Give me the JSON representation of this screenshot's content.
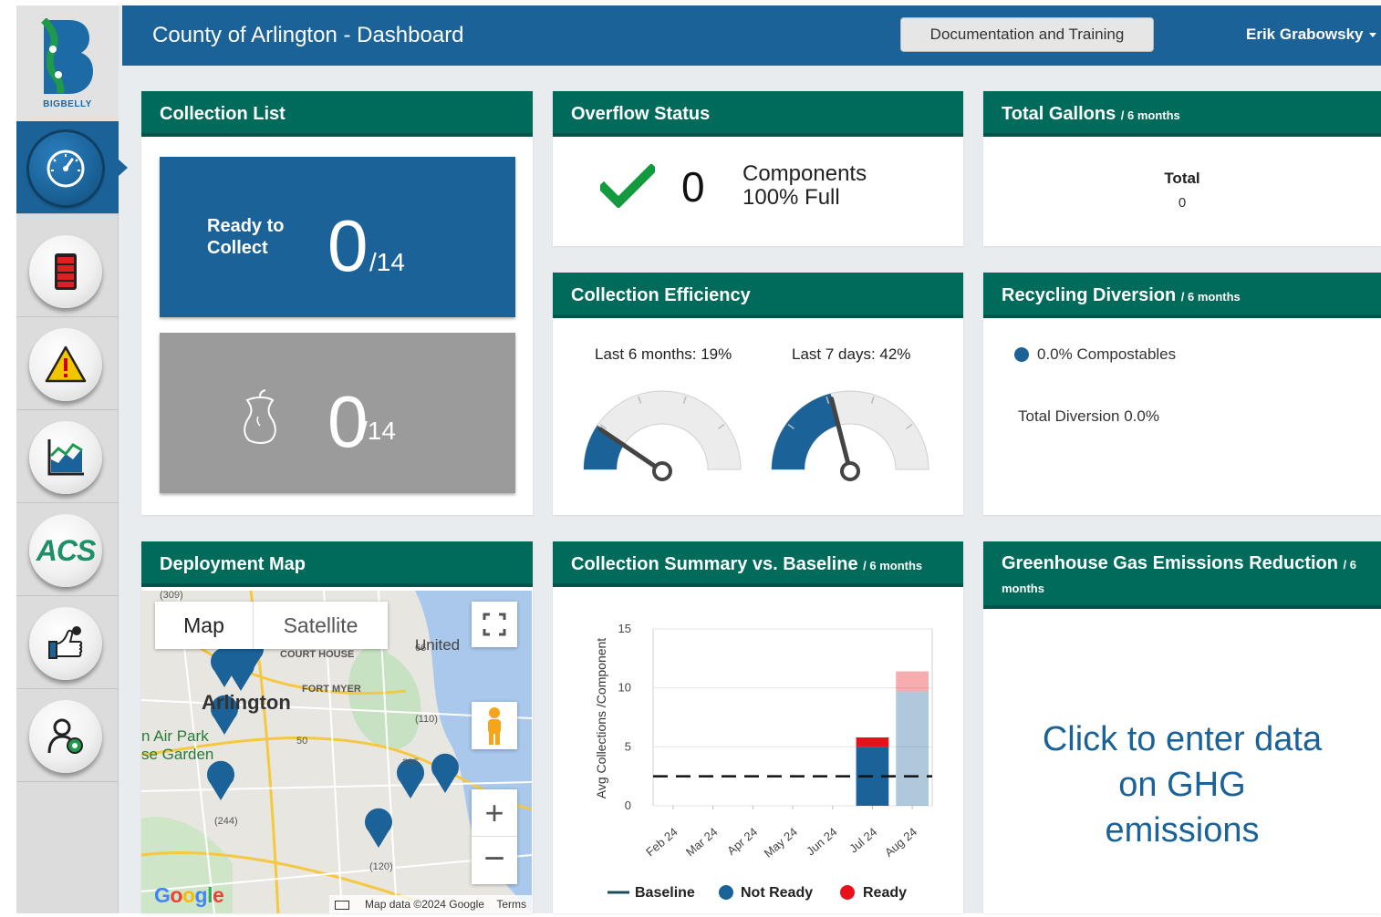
{
  "header": {
    "title": "County of Arlington - Dashboard",
    "doc_button": "Documentation and Training",
    "user": "Erik Grabowsky"
  },
  "sidebar": {
    "logo_text": "BIGBELLY",
    "items": [
      {
        "icon": "speedometer-icon",
        "active": true
      },
      {
        "icon": "fill-level-icon",
        "active": false
      },
      {
        "icon": "warning-icon",
        "active": false
      },
      {
        "icon": "chart-icon",
        "active": false
      },
      {
        "icon": "acs-icon",
        "label": "ACS",
        "active": false
      },
      {
        "icon": "service-hand-icon",
        "active": false
      },
      {
        "icon": "admin-user-icon",
        "active": false
      }
    ]
  },
  "collection_list": {
    "title": "Collection List",
    "ready_label": "Ready to Collect",
    "ready_count": "0",
    "ready_total": "/14",
    "compost_count": "0",
    "compost_total": "/14"
  },
  "overflow": {
    "title": "Overflow Status",
    "count": "0",
    "line1": "Components",
    "line2": "100% Full"
  },
  "total_gallons": {
    "title": "Total Gallons",
    "subtitle": "/ 6 months",
    "total_label": "Total",
    "total_value": "0"
  },
  "efficiency": {
    "title": "Collection Efficiency",
    "six_months_label": "Last 6 months: 19%",
    "seven_days_label": "Last 7 days: 42%",
    "six_months_pct": 19,
    "seven_days_pct": 42
  },
  "recycling": {
    "title": "Recycling Diversion",
    "subtitle": "/ 6 months",
    "item": "0.0% Compostables",
    "total": "Total Diversion  0.0%"
  },
  "map": {
    "title": "Deployment Map",
    "map_tab": "Map",
    "satellite_tab": "Satellite",
    "labels": [
      "Arlington",
      "COURT HOUSE",
      "FORT MYER",
      "United",
      "n Air Park",
      "se Garden"
    ],
    "attribution": "Map data ©2024 Google",
    "terms": "Terms",
    "google": "Google"
  },
  "summary": {
    "title": "Collection Summary vs. Baseline",
    "subtitle": "/ 6 months"
  },
  "chart_data": {
    "type": "bar",
    "categories": [
      "Feb 24",
      "Mar 24",
      "Apr 24",
      "May 24",
      "Jun 24",
      "Jul 24",
      "Aug 24"
    ],
    "series": [
      {
        "name": "Not Ready",
        "values": [
          0,
          0,
          0,
          0,
          0,
          5,
          9.7
        ],
        "color": "#1a6298"
      },
      {
        "name": "Ready",
        "values": [
          0,
          0,
          0,
          0,
          0,
          0.8,
          1.7
        ],
        "color": "#e8101a"
      }
    ],
    "baseline": {
      "name": "Baseline",
      "value": 2.5
    },
    "ylabel": "Avg Collections /Component",
    "yticks": [
      "0",
      "5",
      "10",
      "15"
    ],
    "ylim": [
      0,
      15
    ],
    "legend": [
      "Baseline",
      "Not Ready",
      "Ready"
    ],
    "legend_position": "bottom"
  },
  "ghg": {
    "title": "Greenhouse Gas Emissions Reduction",
    "subtitle": "/ 6 months",
    "cta": "Click to enter data on GHG emissions"
  },
  "colors": {
    "header_blue": "#1a6298",
    "panel_green": "#006b5a",
    "ready_red": "#e8101a",
    "not_ready_blue": "#1a6298"
  }
}
